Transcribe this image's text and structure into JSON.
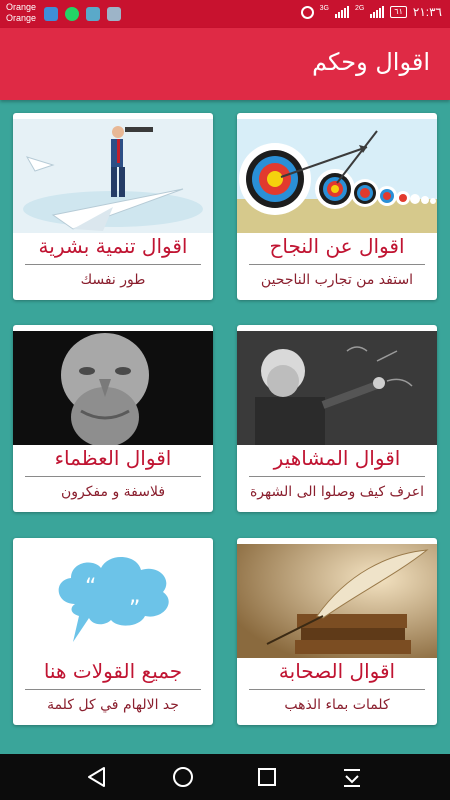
{
  "status_bar": {
    "carrier_line1": "Orange",
    "carrier_line2": "Orange",
    "net_3g": "3G",
    "net_2g": "2G",
    "battery": "٦١",
    "time": "٢١:٣٦",
    "icons_left": [
      "status-app-icon",
      "whatsapp-icon",
      "download-icon",
      "gallery-icon"
    ]
  },
  "app_bar": {
    "title": "اقوال وحكم"
  },
  "cards": [
    {
      "title": "اقوال عن النجاح",
      "subtitle": "استفد من تجارب الناجحين",
      "image": "targets-with-arrows"
    },
    {
      "title": "اقوال تنمية بشرية",
      "subtitle": "طور نفسك",
      "image": "man-on-paper-plane-with-telescope"
    },
    {
      "title": "اقوال المشاهير",
      "subtitle": "اعرف كيف وصلوا الى الشهرة",
      "image": "einstein-at-chalkboard"
    },
    {
      "title": "اقوال العظماء",
      "subtitle": "فلاسفة و مفكرون",
      "image": "socrates-bust"
    },
    {
      "title": "اقوال الصحابة",
      "subtitle": "كلمات بماء الذهب",
      "image": "quill-and-old-books"
    },
    {
      "title": "جميع القولات هنا",
      "subtitle": "جد الالهام في كل كلمة",
      "image": "speech-bubble-with-quotes"
    }
  ],
  "nav_bar": {
    "buttons": [
      "back-icon",
      "home-icon",
      "recents-icon",
      "notification-pulldown-icon"
    ]
  },
  "colors": {
    "status_bar": "#c8122f",
    "app_bar": "#df2a45",
    "background": "#3aa59a",
    "title_text": "#c01432"
  }
}
